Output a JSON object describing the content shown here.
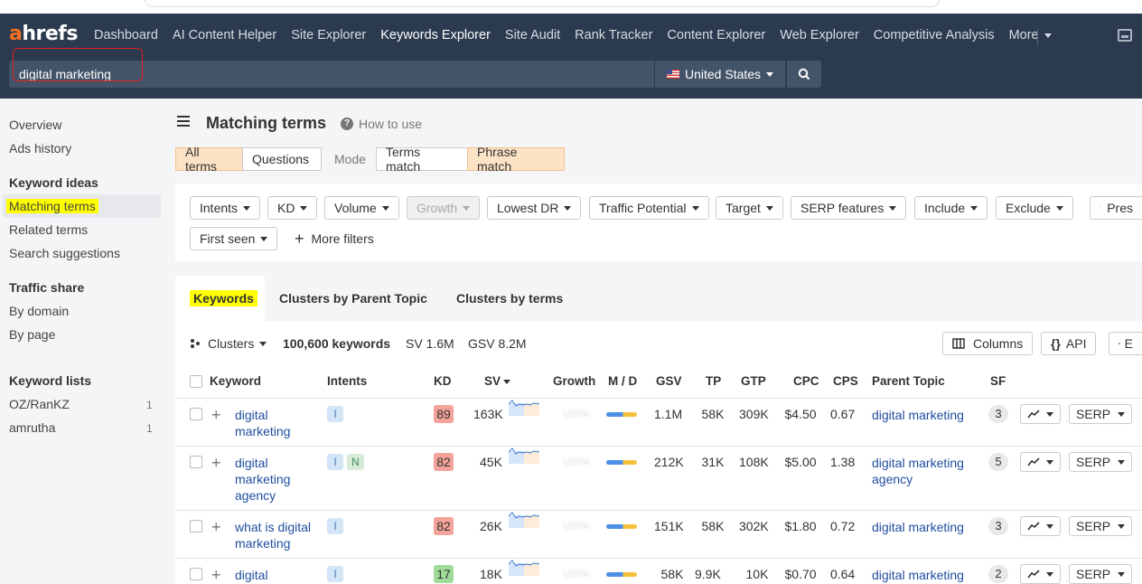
{
  "app": {
    "logo": "ahrefs"
  },
  "nav": {
    "items": [
      "Dashboard",
      "AI Content Helper",
      "Site Explorer",
      "Keywords Explorer",
      "Site Audit",
      "Rank Tracker",
      "Content Explorer",
      "Web Explorer",
      "Competitive Analysis",
      "More"
    ],
    "active": "Keywords Explorer"
  },
  "search": {
    "value": "digital marketing",
    "country": "United States"
  },
  "sidebar": {
    "overview": "Overview",
    "ads_history": "Ads history",
    "ideas_head": "Keyword ideas",
    "matching_terms": "Matching terms",
    "related_terms": "Related terms",
    "search_suggestions": "Search suggestions",
    "traffic_head": "Traffic share",
    "by_domain": "By domain",
    "by_page": "By page",
    "lists_head": "Keyword lists",
    "lists": [
      {
        "name": "OZ/RanKZ",
        "count": "1"
      },
      {
        "name": "amrutha",
        "count": "1"
      }
    ]
  },
  "page": {
    "title": "Matching terms",
    "help": "How to use"
  },
  "segments": {
    "all_terms": "All terms",
    "questions": "Questions",
    "mode": "Mode",
    "terms_match": "Terms match",
    "phrase_match": "Phrase match"
  },
  "filters": {
    "intents": "Intents",
    "kd": "KD",
    "volume": "Volume",
    "growth": "Growth",
    "lowest_dr": "Lowest DR",
    "traffic_potential": "Traffic Potential",
    "target": "Target",
    "serp_features": "SERP features",
    "include": "Include",
    "exclude": "Exclude",
    "presets": "Pres",
    "first_seen": "First seen",
    "more_filters": "More filters"
  },
  "tabs": {
    "keywords": "Keywords",
    "clusters_parent": "Clusters by Parent Topic",
    "clusters_terms": "Clusters by terms"
  },
  "summary": {
    "clusters": "Clusters",
    "count": "100,600 keywords",
    "sv": "SV 1.6M",
    "gsv": "GSV 8.2M",
    "columns": "Columns",
    "api": "API",
    "export": "E"
  },
  "table": {
    "headers": {
      "keyword": "Keyword",
      "intents": "Intents",
      "kd": "KD",
      "sv": "SV",
      "growth": "Growth",
      "md": "M / D",
      "gsv": "GSV",
      "tp": "TP",
      "gtp": "GTP",
      "cpc": "CPC",
      "cps": "CPS",
      "parent": "Parent Topic",
      "sf": "SF"
    },
    "serp_label": "SERP",
    "rows": [
      {
        "kw1": "digital",
        "kw2": "marketing",
        "kw3": "",
        "i1": "I",
        "i2": "",
        "kd": "89",
        "kd_color": "#f4a39a",
        "sv": "163K",
        "growth": "100%",
        "gsv": "1.1M",
        "tp": "58K",
        "gtp": "309K",
        "cpc": "$4.50",
        "cps": "0.67",
        "pt1": "digital marketing",
        "pt2": "",
        "sf": "3"
      },
      {
        "kw1": "digital",
        "kw2": "marketing",
        "kw3": "agency",
        "i1": "I",
        "i2": "N",
        "kd": "82",
        "kd_color": "#f4a39a",
        "sv": "45K",
        "growth": "100%",
        "gsv": "212K",
        "tp": "31K",
        "gtp": "108K",
        "cpc": "$5.00",
        "cps": "1.38",
        "pt1": "digital marketing",
        "pt2": "agency",
        "sf": "5"
      },
      {
        "kw1": "what is digital",
        "kw2": "marketing",
        "kw3": "",
        "i1": "I",
        "i2": "",
        "kd": "82",
        "kd_color": "#f4a39a",
        "sv": "26K",
        "growth": "100%",
        "gsv": "151K",
        "tp": "58K",
        "gtp": "302K",
        "cpc": "$1.80",
        "cps": "0.72",
        "pt1": "digital marketing",
        "pt2": "",
        "sf": "3"
      },
      {
        "kw1": "digital",
        "kw2": "",
        "kw3": "",
        "i1": "I",
        "i2": "",
        "kd": "17",
        "kd_color": "#9fdc9a",
        "sv": "18K",
        "growth": "100%",
        "gsv": "58K",
        "tp": "9.9K",
        "gtp": "10K",
        "cpc": "$0.70",
        "cps": "0.64",
        "pt1": "digital marketing",
        "pt2": "",
        "sf": "2"
      }
    ]
  },
  "colors": {
    "nav_bg": "#2b3a4e",
    "accent_orange": "#f37021",
    "highlight": "#ffff00",
    "link": "#1f4d9e"
  }
}
